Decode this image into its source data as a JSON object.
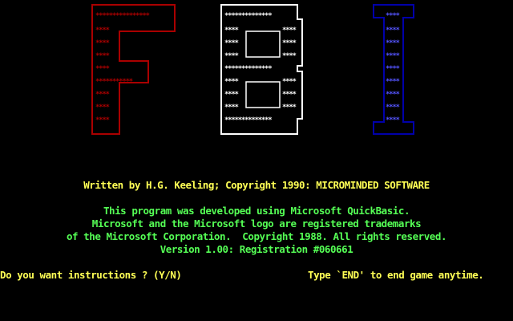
{
  "colors": {
    "background": "#000000",
    "logo_f": "#AA0000",
    "logo_b": "#FFFFFF",
    "logo_i": "#0000AA",
    "logo_i_fill": "#5555FF",
    "credits": "#FFFF55",
    "info": "#55FF55"
  },
  "logo": {
    "letters": [
      "F",
      "B",
      "I"
    ],
    "fill_glyph": "*"
  },
  "credits": {
    "line": "Written by H.G. Keeling; Copyright 1990: MICROMINDED SOFTWARE"
  },
  "info": {
    "line1": "This program was developed using Microsoft QuickBasic.",
    "line2": "Microsoft and the Microsoft logo are registered trademarks",
    "line3": "of the Microsoft Corporation.  Copyright 1988. All rights reserved.",
    "line4": "Version 1.00: Registration #060661"
  },
  "prompt": {
    "question": "Do you want instructions ? (Y/N)",
    "hint": "Type `END' to end game anytime."
  }
}
